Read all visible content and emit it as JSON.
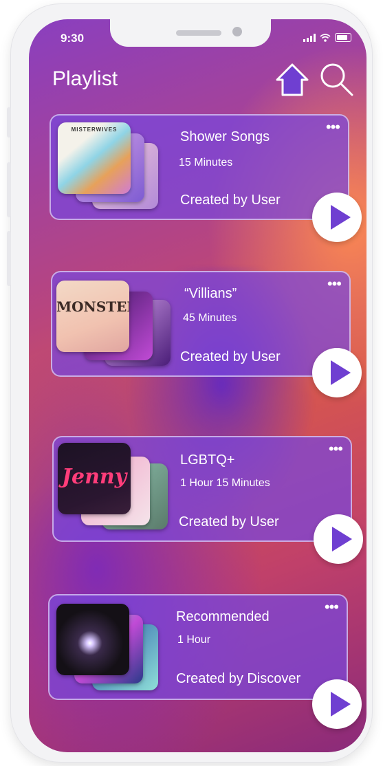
{
  "status": {
    "time": "9:30"
  },
  "header": {
    "title": "Playlist",
    "home_icon": "home-icon",
    "search_icon": "search-icon"
  },
  "colors": {
    "card": "#7a46dc",
    "accent": "#6f3fd1",
    "text": "#ffffff"
  },
  "playlists": [
    {
      "name": "Shower Songs",
      "duration": "15 Minutes",
      "creator": "Created by User",
      "art_label": "MISTERWIVES",
      "more": "•••"
    },
    {
      "name": "“Villians”",
      "duration": "45 Minutes",
      "creator": "Created by User",
      "art_label": "MONSTER",
      "more": "•••"
    },
    {
      "name": "LGBTQ+",
      "duration": "1 Hour 15 Minutes",
      "creator": "Created by User",
      "art_label": "Jenny",
      "more": "•••"
    },
    {
      "name": "Recommended",
      "duration": "1 Hour",
      "creator": "Created by Discover",
      "art_label": "",
      "more": "•••"
    }
  ]
}
